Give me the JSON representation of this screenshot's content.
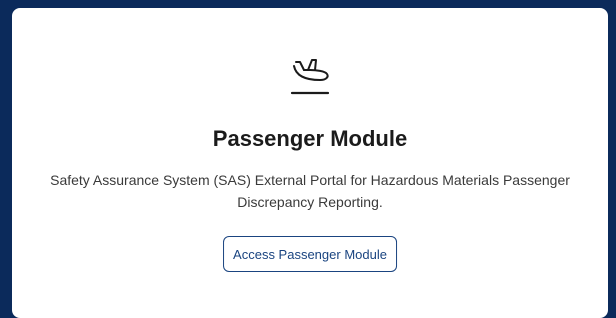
{
  "card": {
    "icon": "airplane-landing-icon",
    "title": "Passenger Module",
    "description": "Safety Assurance System (SAS) External Portal for Hazardous Materials Passenger Discrepancy Reporting.",
    "button_label": "Access Passenger Module"
  },
  "colors": {
    "background": "#0b2a5b",
    "card": "#ffffff",
    "accent": "#1a4480",
    "title": "#1b1b1b",
    "text": "#3a3a3a"
  }
}
